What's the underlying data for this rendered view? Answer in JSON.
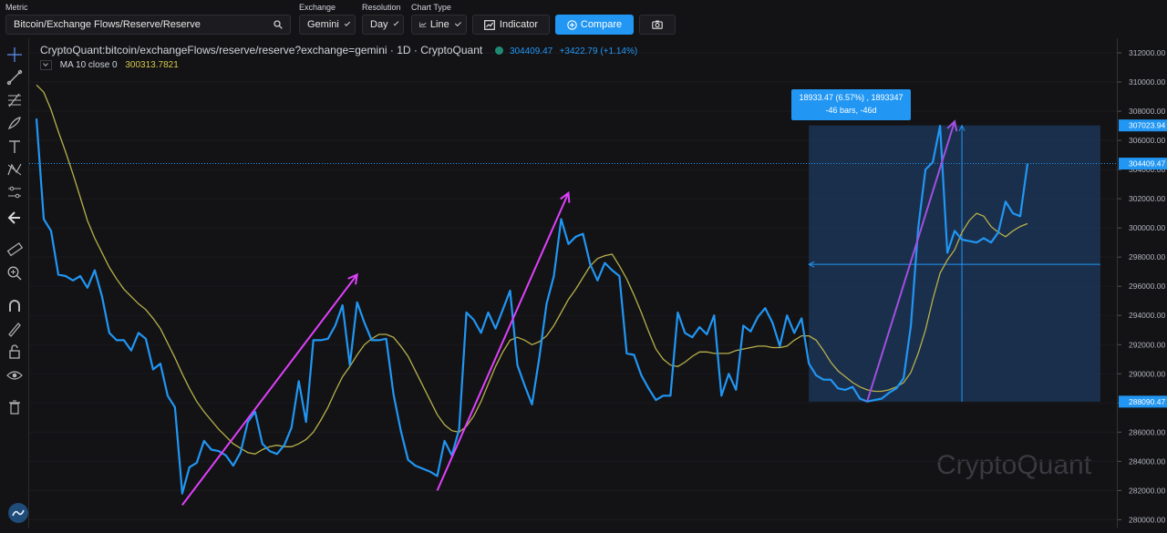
{
  "toolbar": {
    "metric_label": "Metric",
    "metric_value": "Bitcoin/Exchange Flows/Reserve/Reserve",
    "exchange_label": "Exchange",
    "exchange_value": "Gemini",
    "resolution_label": "Resolution",
    "resolution_value": "Day",
    "chart_type_label": "Chart Type",
    "chart_type_value": "Line",
    "indicator_label": "Indicator",
    "compare_label": "Compare",
    "icons": [
      "search-icon",
      "chevron-down-icon",
      "line-chart-icon",
      "indicator-icon",
      "plus-circle-icon",
      "camera-icon"
    ]
  },
  "sidebar_tools": [
    "crosshair-icon",
    "trend-line-icon",
    "fib-icon",
    "brush-icon",
    "text-icon",
    "pattern-icon",
    "prediction-icon",
    "back-arrow-icon",
    "ruler-icon",
    "zoom-in-icon",
    "magnet-icon",
    "lock-draw-icon",
    "lock-icon",
    "eye-icon",
    "trash-icon"
  ],
  "legend": {
    "symbol": "CryptoQuant:bitcoin/exchangeFlows/reserve/reserve?exchange=gemini · 1D · CryptoQuant",
    "last_value": "304409.47",
    "change": "+3422.79 (+1.14%)",
    "ma_label": "MA 10 close 0",
    "ma_value": "300313.7821"
  },
  "watermark": "CryptoQuant",
  "measure_box": {
    "line1": "18933.47 (6.57%) , 1893347",
    "line2": "-46 bars, -46d"
  },
  "price_tags": {
    "last": "304409.47",
    "range_high": "307023.94",
    "range_low": "288090.47"
  },
  "colors": {
    "background": "#131316",
    "series": "#2196f3",
    "ma": "#b7b04a",
    "arrow": "#e040fb",
    "measure_fill": "#1e3a5f",
    "tag": "#2196f3"
  },
  "chart_data": {
    "type": "line",
    "title": "CryptoQuant:bitcoin/exchangeFlows/reserve/reserve?exchange=gemini · 1D · CryptoQuant",
    "ylim": [
      279400,
      313000
    ],
    "y_ticks": [
      280000,
      282000,
      284000,
      286000,
      288000,
      290000,
      292000,
      294000,
      296000,
      298000,
      300000,
      302000,
      304000,
      306000,
      308000,
      310000,
      312000
    ],
    "series": [
      {
        "name": "Reserve",
        "values": [
          307500,
          300600,
          299800,
          296800,
          296700,
          296400,
          296700,
          295900,
          297100,
          295300,
          292800,
          292300,
          292300,
          291600,
          292800,
          292400,
          290300,
          290700,
          288500,
          287700,
          281800,
          283600,
          283900,
          285400,
          284800,
          284700,
          284400,
          283700,
          284600,
          286700,
          287400,
          285200,
          284700,
          284500,
          285100,
          286300,
          289500,
          286700,
          292300,
          292300,
          292400,
          293300,
          294700,
          290600,
          294900,
          293500,
          292300,
          292300,
          292400,
          288600,
          286100,
          284100,
          283700,
          283500,
          283300,
          283000,
          285400,
          284400,
          286200,
          294200,
          293700,
          292800,
          294200,
          293100,
          294400,
          295700,
          290600,
          289200,
          287900,
          291100,
          294800,
          296700,
          300600,
          298900,
          299400,
          299600,
          297500,
          296400,
          297600,
          297100,
          296700,
          291400,
          291300,
          289900,
          289000,
          288200,
          288500,
          288500,
          294200,
          292800,
          292500,
          293200,
          292700,
          294000,
          288500,
          290000,
          288900,
          293300,
          292900,
          293900,
          294500,
          293500,
          291900,
          294000,
          292800,
          293800,
          290700,
          289900,
          289600,
          289600,
          289000,
          288900,
          289100,
          288300,
          288100,
          288200,
          288300,
          288700,
          289000,
          289700,
          293300,
          300000,
          304000,
          304500,
          307000,
          298300,
          299800,
          299200,
          299100,
          299000,
          299300,
          299000,
          299700,
          301800,
          301000,
          300800,
          304400
        ]
      },
      {
        "name": "MA 10 close 0",
        "values": [
          309800,
          309300,
          308100,
          306600,
          305200,
          303700,
          302100,
          300500,
          299300,
          298300,
          297300,
          296500,
          295800,
          295300,
          294800,
          294400,
          293800,
          293100,
          292100,
          291100,
          290000,
          289000,
          288100,
          287400,
          286800,
          286200,
          285700,
          285200,
          284900,
          284600,
          284500,
          284800,
          285000,
          285100,
          285000,
          285000,
          285200,
          285500,
          286000,
          286800,
          287700,
          288800,
          289800,
          290500,
          291300,
          292000,
          292400,
          292700,
          292700,
          292500,
          291900,
          291200,
          290200,
          289200,
          288200,
          287200,
          286500,
          286100,
          286000,
          286400,
          287100,
          288100,
          289300,
          290500,
          291500,
          292300,
          292500,
          292300,
          292000,
          292200,
          292600,
          293300,
          294200,
          295100,
          295800,
          296600,
          297400,
          297900,
          298100,
          298200,
          297400,
          296500,
          295400,
          294200,
          292900,
          291700,
          291000,
          290600,
          290500,
          290800,
          291200,
          291500,
          291500,
          291400,
          291400,
          291400,
          291600,
          291700,
          291800,
          291900,
          291900,
          291800,
          291800,
          291900,
          292300,
          292600,
          292600,
          292300,
          291600,
          290800,
          290200,
          289800,
          289400,
          289100,
          288900,
          288800,
          288800,
          288900,
          289100,
          289400,
          290100,
          291400,
          293000,
          295100,
          296900,
          297800,
          298500,
          299700,
          300500,
          301000,
          300800,
          300100,
          299700,
          299400,
          299800,
          300100,
          300300
        ]
      }
    ],
    "annotations": {
      "arrows": [
        {
          "from": [
            20,
            281000
          ],
          "to": [
            44,
            296800
          ]
        },
        {
          "from": [
            55,
            282000
          ],
          "to": [
            73,
            302400
          ]
        },
        {
          "from": [
            114,
            288100
          ],
          "to": [
            126,
            307300
          ]
        }
      ],
      "measure_range": {
        "x_from": 106,
        "x_to": 146,
        "y_from": 288090.47,
        "y_to": 307023.94
      },
      "vertical_marker_x": 127,
      "horizontal_marker_y": 297500
    }
  }
}
